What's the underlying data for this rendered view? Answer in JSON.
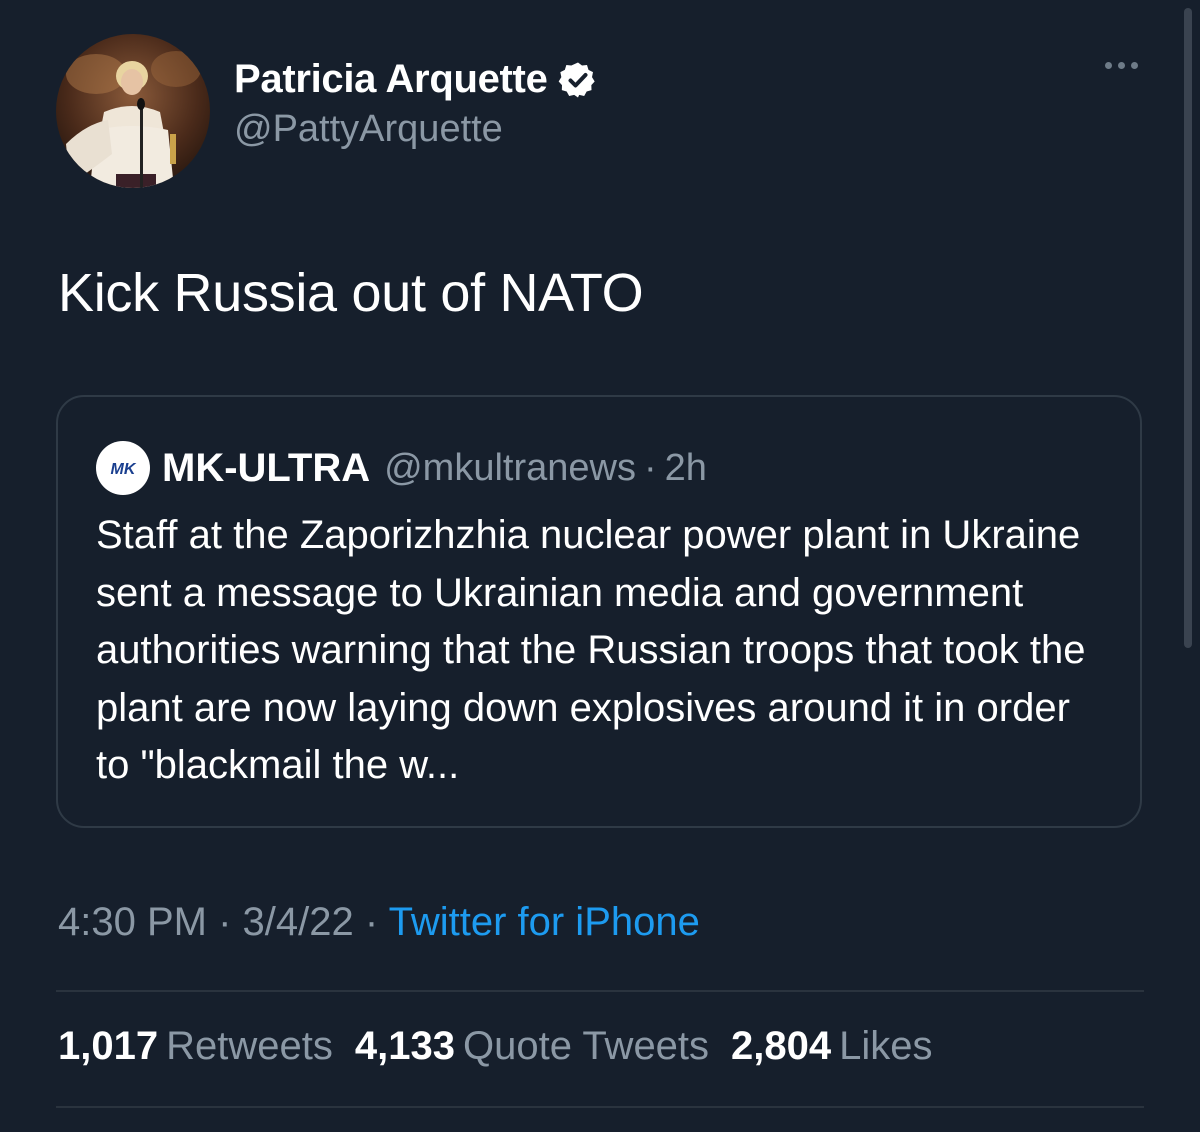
{
  "tweet": {
    "author": {
      "display_name": "Patricia Arquette",
      "handle": "@PattyArquette",
      "verified": true,
      "avatar": "profile-photo"
    },
    "more_icon": "more-horizontal-icon",
    "text": "Kick Russia out of NATO",
    "quoted": {
      "display_name": "MK-ULTRA",
      "handle": "@mkultranews",
      "separator": "·",
      "time": "2h",
      "avatar_logo_text": "MK",
      "body": "Staff at the Zaporizhzhia nuclear power plant in Ukraine sent a message to Ukrainian media and government authorities warning that the Russian troops that took the plant are now laying down explosives around it in order to \"blackmail the w..."
    },
    "meta": {
      "time": "4:30 PM",
      "sep1": "·",
      "date": "3/4/22",
      "sep2": "·",
      "source": "Twitter for iPhone"
    },
    "stats": [
      {
        "count": "1,017",
        "label": "Retweets"
      },
      {
        "count": "4,133",
        "label": "Quote Tweets"
      },
      {
        "count": "2,804",
        "label": "Likes"
      }
    ]
  },
  "colors": {
    "background": "#161f2c",
    "secondary_text": "#8b98a5",
    "link": "#1d9bf0",
    "border": "#2f3a46"
  }
}
